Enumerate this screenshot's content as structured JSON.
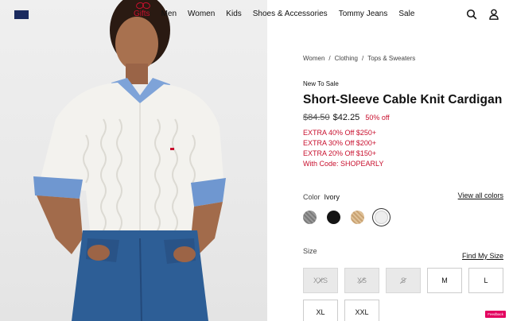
{
  "header": {
    "nav": [
      "Gifts",
      "Men",
      "Women",
      "Kids",
      "Shoes & Accessories",
      "Tommy Jeans",
      "Sale"
    ],
    "icons": [
      "search-icon",
      "account-icon"
    ]
  },
  "breadcrumb": [
    "Women",
    "Clothing",
    "Tops & Sweaters"
  ],
  "product": {
    "tag": "New To Sale",
    "title": "Short-Sleeve Cable Knit Cardigan",
    "original_price": "$84.50",
    "sale_price": "$42.25",
    "discount": "50% off",
    "offers": [
      "EXTRA 40% Off $250+",
      "EXTRA 30% Off $200+",
      "EXTRA 20% Off $150+",
      "With Code: SHOPEARLY"
    ]
  },
  "color": {
    "label": "Color",
    "selected": "Ivory",
    "view_all": "View all colors",
    "swatches": [
      "#8c8c8c",
      "#141414",
      "#d6b48a",
      "#eeeeee"
    ]
  },
  "size": {
    "label": "Size",
    "guide": "Find My Size",
    "options": [
      {
        "label": "XXS",
        "available": false
      },
      {
        "label": "XS",
        "available": false
      },
      {
        "label": "S",
        "available": false
      },
      {
        "label": "M",
        "available": true
      },
      {
        "label": "L",
        "available": true
      },
      {
        "label": "XL",
        "available": true
      },
      {
        "label": "XXL",
        "available": true
      }
    ]
  },
  "feedback_label": "Feedback",
  "colors": {
    "brand_red": "#c8102e",
    "navy": "#1a2a5e"
  }
}
